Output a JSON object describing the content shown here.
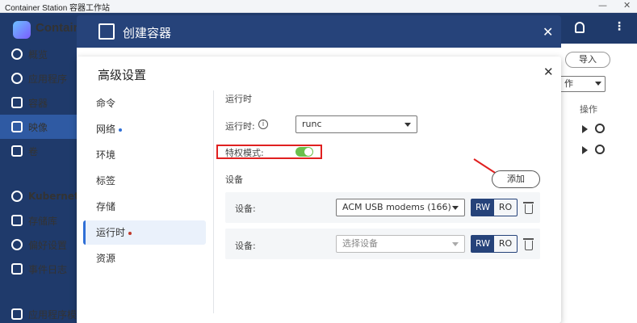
{
  "os_window": {
    "title": "Container Station 容器工作站",
    "minimize": "—",
    "close": "✕"
  },
  "sidebar": {
    "logo_text": "Contain",
    "items": [
      {
        "label": "概览",
        "icon": "dashboard-icon"
      },
      {
        "label": "应用程序",
        "icon": "apps-icon"
      },
      {
        "label": "容器",
        "icon": "cube-icon"
      },
      {
        "label": "映像",
        "icon": "layers-icon"
      },
      {
        "label": "卷",
        "icon": "database-icon"
      },
      {
        "label": "Kubernetes",
        "icon": "kubernetes-icon"
      },
      {
        "label": "存储库",
        "icon": "grid-icon"
      },
      {
        "label": "偏好设置",
        "icon": "gear-icon"
      },
      {
        "label": "事件日志",
        "icon": "list-icon"
      },
      {
        "label": "应用程序模",
        "icon": "template-icon"
      }
    ]
  },
  "background": {
    "import_label": "导入",
    "select_value": "作",
    "ops_header": "操作"
  },
  "outer_dialog": {
    "title": "创建容器",
    "close": "✕"
  },
  "inner_dialog": {
    "title": "高级设置",
    "close": "✕",
    "tabs": [
      {
        "label": "命令"
      },
      {
        "label": "网络"
      },
      {
        "label": "环境"
      },
      {
        "label": "标签"
      },
      {
        "label": "存储"
      },
      {
        "label": "运行时"
      },
      {
        "label": "资源"
      }
    ],
    "runtime_section": "运行时",
    "runtime_label": "运行时:",
    "runtime_value": "runc",
    "privileged_label": "特权模式:",
    "devices_section": "设备",
    "add_label": "添加",
    "device_label": "设备:",
    "device1_value": "ACM USB modems (166)",
    "device2_placeholder": "选择设备",
    "rw": "RW",
    "ro": "RO"
  },
  "colors": {
    "accent": "#2f6fd6",
    "header": "#26437a",
    "toggle_on": "#6abf4b",
    "highlight": "#e02020"
  }
}
